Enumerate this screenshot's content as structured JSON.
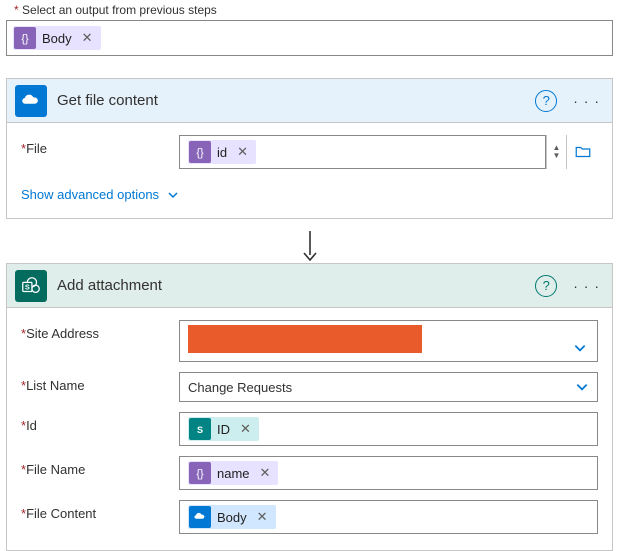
{
  "topLabel": "Select an output from previous steps",
  "topToken": {
    "label": "Body"
  },
  "getFile": {
    "title": "Get file content",
    "paramLabel": "File",
    "token": {
      "label": "id"
    },
    "advanced": "Show advanced options"
  },
  "addAttach": {
    "title": "Add attachment",
    "site": {
      "label": "Site Address"
    },
    "list": {
      "label": "List Name",
      "value": "Change Requests"
    },
    "id": {
      "label": "Id",
      "token": "ID"
    },
    "fname": {
      "label": "File Name",
      "token": "name"
    },
    "fcont": {
      "label": "File Content",
      "token": "Body"
    }
  },
  "glyphs": {
    "remove": "✕",
    "help": "?",
    "ellipsis": "· · ·",
    "spinUp": "▲",
    "spinDown": "▼"
  }
}
